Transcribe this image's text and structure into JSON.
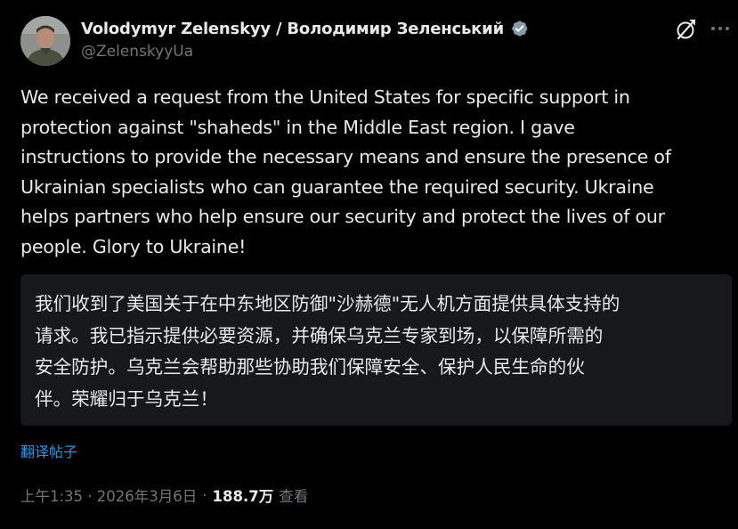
{
  "post": {
    "author": {
      "display_name": "Volodymyr Zelenskyy / Володимир Зеленський",
      "handle": "@ZelenskyyUa",
      "verified": true,
      "verified_badge_color": "#829aab"
    },
    "body_lines": [
      "We received a request from the United States for specific support in",
      "protection against \"shaheds\" in the Middle East region. I gave",
      "instructions to provide the necessary means and ensure the presence of",
      "Ukrainian specialists who can guarantee the required security. Ukraine",
      "helps partners who help ensure our security and protect the lives of our",
      "people. Glory to Ukraine!"
    ],
    "translation_lines": [
      "我们收到了美国关于在中东地区防御\"沙赫德\"无人机方面提供具体支持的",
      "请求。我已指示提供必要资源，并确保乌克兰专家到场，以保障所需的",
      "安全防护。乌克兰会帮助那些协助我们保障安全、保护人民生命的伙",
      "伴。荣耀归于乌克兰！"
    ],
    "translate_link": "翻译帖子",
    "timestamp": "上午1:35 · 2026年3月6日",
    "separator": "·",
    "views_count": "188.7万",
    "views_label": "查看"
  },
  "icons": {
    "grok": "grok-icon",
    "more": "more-icon",
    "verified": "verified-badge-icon"
  },
  "colors": {
    "background": "#000000",
    "text": "#e7e9ea",
    "secondary_text": "#71767b",
    "link": "#1d9bf0",
    "translation_box": "#16181c"
  }
}
